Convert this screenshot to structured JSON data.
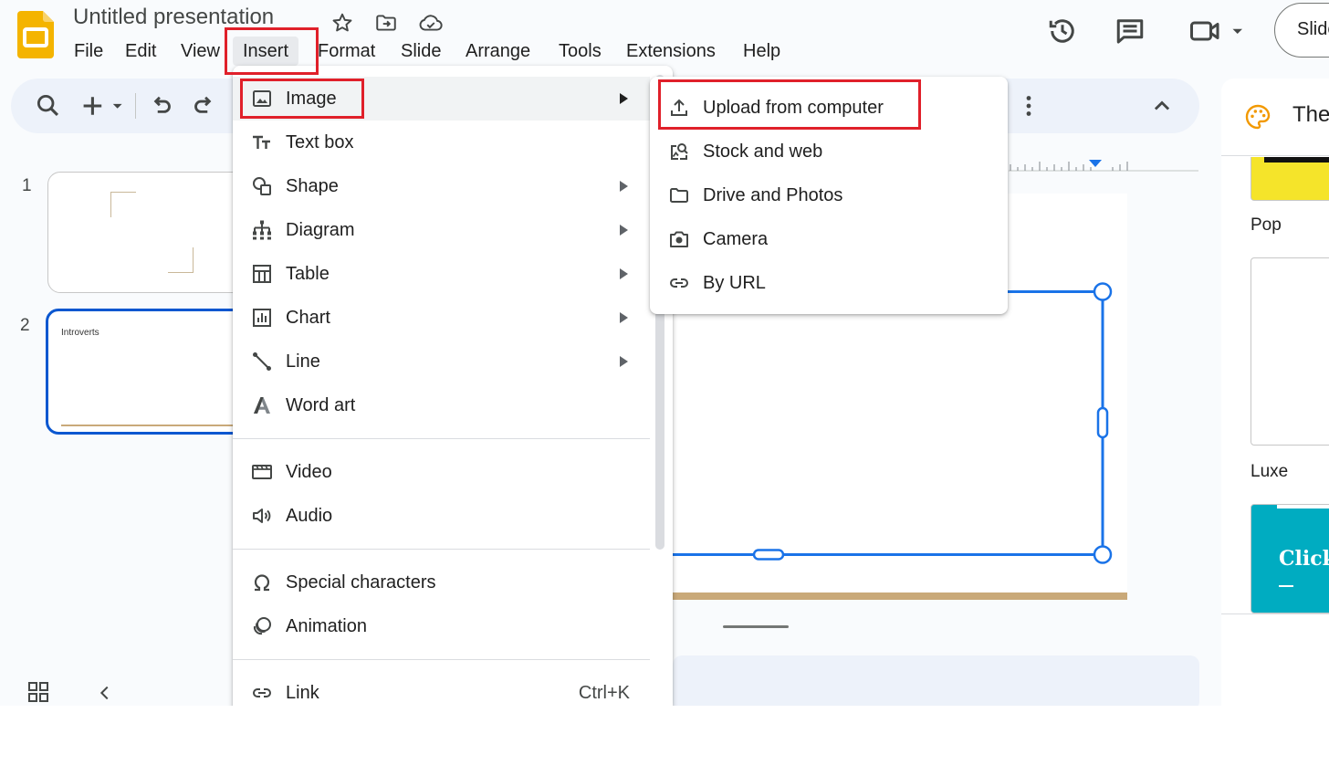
{
  "app": {
    "doc_title": "Untitled presentation",
    "slideshow_label": "Slideshow"
  },
  "menubar": {
    "items": [
      "File",
      "Edit",
      "View",
      "Insert",
      "Format",
      "Slide",
      "Arrange",
      "Tools",
      "Extensions",
      "Help"
    ],
    "active": "Insert"
  },
  "filmstrip": {
    "slides": [
      {
        "number": "1",
        "text": ""
      },
      {
        "number": "2",
        "text": "Introverts"
      }
    ]
  },
  "themes": {
    "title": "Themes",
    "items": [
      {
        "name": "Pop"
      },
      {
        "name": "Luxe"
      },
      {
        "name": "",
        "preview_text": "Click"
      }
    ]
  },
  "insert_menu": {
    "items": [
      {
        "label": "Image",
        "icon": "image-icon",
        "submenu": true
      },
      {
        "label": "Text box",
        "icon": "text-box-icon",
        "submenu": false
      },
      {
        "label": "Shape",
        "icon": "shape-icon",
        "submenu": true
      },
      {
        "label": "Diagram",
        "icon": "diagram-icon",
        "submenu": true
      },
      {
        "label": "Table",
        "icon": "table-icon",
        "submenu": true
      },
      {
        "label": "Chart",
        "icon": "chart-icon",
        "submenu": true
      },
      {
        "label": "Line",
        "icon": "line-icon",
        "submenu": true
      },
      {
        "label": "Word art",
        "icon": "word-art-icon",
        "submenu": false
      },
      {
        "label": "Video",
        "icon": "video-icon",
        "submenu": false
      },
      {
        "label": "Audio",
        "icon": "audio-icon",
        "submenu": false
      },
      {
        "label": "Special characters",
        "icon": "omega-icon",
        "submenu": false
      },
      {
        "label": "Animation",
        "icon": "animation-icon",
        "submenu": false
      },
      {
        "label": "Link",
        "icon": "link-icon",
        "submenu": false,
        "shortcut": "Ctrl+K"
      }
    ]
  },
  "image_submenu": {
    "items": [
      {
        "label": "Upload from computer",
        "icon": "upload-icon"
      },
      {
        "label": "Stock and web",
        "icon": "stock-image-search-icon"
      },
      {
        "label": "Drive and Photos",
        "icon": "folder-icon"
      },
      {
        "label": "Camera",
        "icon": "camera-icon"
      },
      {
        "label": "By URL",
        "icon": "link-icon"
      }
    ]
  },
  "colors": {
    "highlight": "#e0202a",
    "accent": "#0b57d0",
    "logo": "#f4b400",
    "selection": "#1a73e8"
  }
}
